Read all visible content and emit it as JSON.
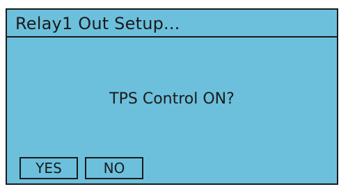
{
  "dialog": {
    "title": "Relay1 Out Setup...",
    "message": "TPS Control ON?",
    "yes_label": "YES",
    "no_label": "NO"
  },
  "colors": {
    "background": "#6cc0dc",
    "border": "#1a1a1a",
    "text": "#1a1a1a"
  }
}
